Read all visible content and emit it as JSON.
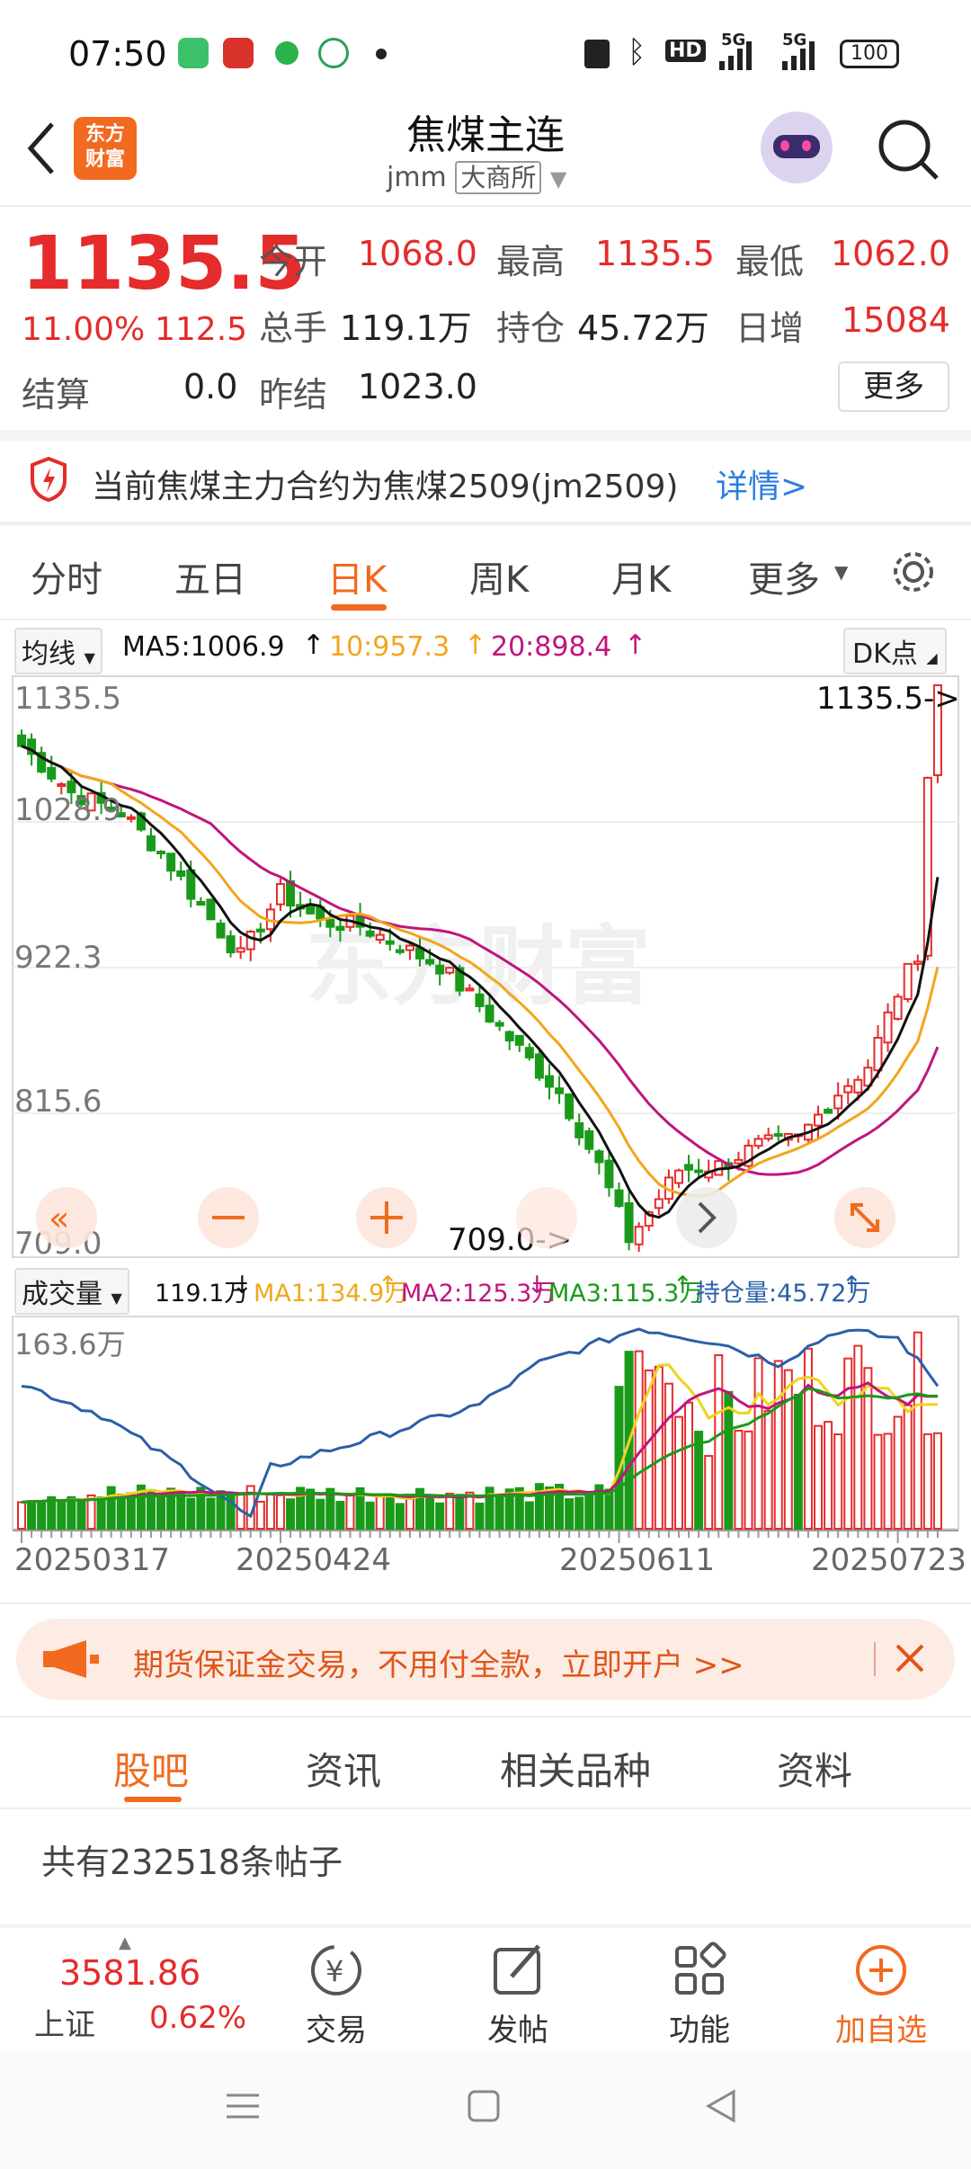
{
  "status": {
    "time": "07:50",
    "battery": "100",
    "net1": "5G",
    "net2": "5G",
    "hd": "HD"
  },
  "header": {
    "title": "焦煤主连",
    "code": "jmm",
    "exchange": "大商所",
    "logo_line1": "东方",
    "logo_line2": "财富"
  },
  "quote": {
    "price": "1135.5",
    "pct": "11.00%",
    "change": "112.5",
    "open_label": "今开",
    "open": "1068.0",
    "high_label": "最高",
    "high": "1135.5",
    "low_label": "最低",
    "low": "1062.0",
    "volume_label": "总手",
    "volume": "119.1万",
    "oi_label": "持仓",
    "oi": "45.72万",
    "dayinc_label": "日增",
    "dayinc": "15084",
    "settle_label": "结算",
    "settle": "0.0",
    "presettle_label": "昨结",
    "presettle": "1023.0",
    "more_btn": "更多"
  },
  "notice": {
    "text": "当前焦煤主力合约为焦煤2509(jm2509)",
    "link": "详情>"
  },
  "period_tabs": [
    "分时",
    "五日",
    "日K",
    "周K",
    "月K",
    "更多"
  ],
  "active_tab": "日K",
  "ma_bar": {
    "selector": "均线",
    "ma5": "MA5:1006.9",
    "ma10": "10:957.3",
    "ma20": "20:898.4",
    "dk": "DK点"
  },
  "price_chart": {
    "y_labels": [
      "1135.5",
      "1028.9",
      "922.3",
      "815.6",
      "709.0"
    ],
    "high_marker": "1135.5->",
    "low_marker": "709.0->",
    "watermark": "东方财富",
    "colors": {
      "up": "#e52b2b",
      "down": "#1a9a1a",
      "ma5": "#111111",
      "ma10": "#f2a61c",
      "ma20": "#c0157d"
    }
  },
  "vol_bar": {
    "selector": "成交量",
    "vol": "119.1万",
    "ma1": "MA1:134.9万",
    "ma2": "MA2:125.3万",
    "ma3": "MA3:115.3万",
    "oi": "持仓量:45.72万"
  },
  "vol_chart": {
    "y_label": "163.6万",
    "dates": [
      "20250317",
      "20250424",
      "20250611",
      "20250723"
    ]
  },
  "promo": {
    "text": "期货保证金交易，不用付全款，立即开户 >>"
  },
  "section_tabs": [
    "股吧",
    "资讯",
    "相关品种",
    "资料"
  ],
  "posts": {
    "text": "共有232518条帖子"
  },
  "index": {
    "value": "3581.86",
    "name": "上证",
    "pct": "0.62%"
  },
  "bottom_nav": [
    "交易",
    "发帖",
    "功能",
    "加自选"
  ],
  "chart_data": {
    "type": "candlestick",
    "title": "焦煤主连 日K",
    "x_range": [
      "20250317",
      "20250723"
    ],
    "ylim": [
      709.0,
      1135.5
    ],
    "last": {
      "open": 1068.0,
      "high": 1135.5,
      "low": 1062.0,
      "close": 1135.5
    },
    "period_low": 709.0,
    "ma": {
      "MA5": 1006.9,
      "MA10": 957.3,
      "MA20": 898.4
    },
    "volume_ylim_max": "163.6万"
  }
}
